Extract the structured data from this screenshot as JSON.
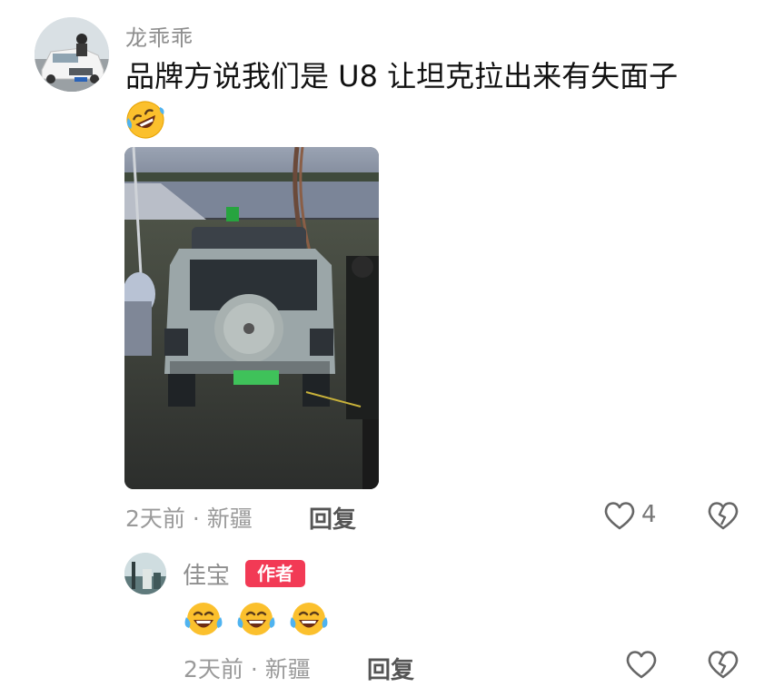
{
  "comment": {
    "username": "龙乖乖",
    "text": "品牌方说我们是 U8 让坦克拉出来有失面子",
    "emoji": "rolling-on-the-floor-laughing",
    "time_location": "2天前 · 新疆",
    "reply_label": "回复",
    "like_count": "4"
  },
  "reply": {
    "username": "佳宝",
    "badge": "作者",
    "emoji": [
      "face-with-tears-of-joy",
      "face-with-tears-of-joy",
      "face-with-tears-of-joy"
    ],
    "time_location": "2天前 · 新疆",
    "reply_label": "回复"
  },
  "colors": {
    "badge_bg": "#f23a55",
    "meta_text": "#9a9a9a",
    "username": "#8e8e8e"
  }
}
